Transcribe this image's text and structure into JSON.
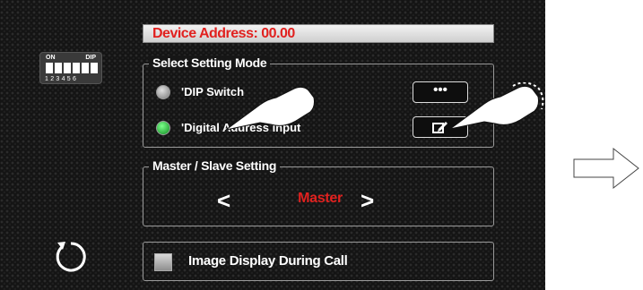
{
  "dip_icon": {
    "on_label": "ON",
    "dip_label": "DIP",
    "numbers": "123456"
  },
  "address": {
    "text": "Device Address: 00.00"
  },
  "select_mode": {
    "title": "Select Setting Mode",
    "options": [
      {
        "label": "'DIP Switch",
        "selected": false
      },
      {
        "label": "'Digital Address Input",
        "selected": true
      }
    ],
    "more_button": "•••"
  },
  "master_slave": {
    "title": "Master / Slave Setting",
    "prev": "<",
    "next": ">",
    "value": "Master"
  },
  "image_display": {
    "label": "Image Display During Call",
    "checked": false
  },
  "colors": {
    "accent_red": "#e1211f",
    "selected_green": "#19a32e",
    "screen_bg": "#141414"
  },
  "icons": {
    "back": "back-rotate-icon",
    "edit": "edit-icon",
    "pointer": "pointing-hand-icon",
    "next": "right-arrow-icon"
  }
}
